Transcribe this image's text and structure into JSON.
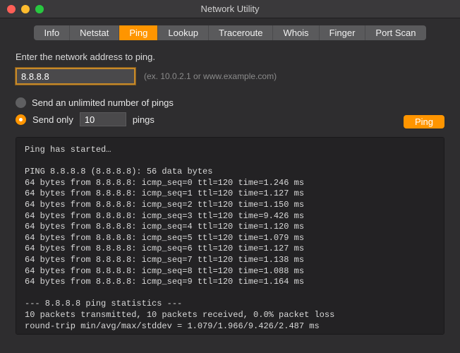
{
  "window": {
    "title": "Network Utility"
  },
  "tabs": {
    "info": "Info",
    "netstat": "Netstat",
    "ping": "Ping",
    "lookup": "Lookup",
    "traceroute": "Traceroute",
    "whois": "Whois",
    "finger": "Finger",
    "portscan": "Port Scan"
  },
  "form": {
    "prompt": "Enter the network address to ping.",
    "address": "8.8.8.8",
    "hint": "(ex. 10.0.2.1 or www.example.com)",
    "unlimited_label": "Send an unlimited number of pings",
    "sendonly_label": "Send only",
    "count": "10",
    "pings_suffix": "pings",
    "ping_button": "Ping"
  },
  "output": {
    "started": "Ping has started…",
    "header": "PING 8.8.8.8 (8.8.8.8): 56 data bytes",
    "lines": [
      "64 bytes from 8.8.8.8: icmp_seq=0 ttl=120 time=1.246 ms",
      "64 bytes from 8.8.8.8: icmp_seq=1 ttl=120 time=1.127 ms",
      "64 bytes from 8.8.8.8: icmp_seq=2 ttl=120 time=1.150 ms",
      "64 bytes from 8.8.8.8: icmp_seq=3 ttl=120 time=9.426 ms",
      "64 bytes from 8.8.8.8: icmp_seq=4 ttl=120 time=1.120 ms",
      "64 bytes from 8.8.8.8: icmp_seq=5 ttl=120 time=1.079 ms",
      "64 bytes from 8.8.8.8: icmp_seq=6 ttl=120 time=1.127 ms",
      "64 bytes from 8.8.8.8: icmp_seq=7 ttl=120 time=1.138 ms",
      "64 bytes from 8.8.8.8: icmp_seq=8 ttl=120 time=1.088 ms",
      "64 bytes from 8.8.8.8: icmp_seq=9 ttl=120 time=1.164 ms"
    ],
    "stats_divider": "--- 8.8.8.8 ping statistics ---",
    "stats_summary": "10 packets transmitted, 10 packets received, 0.0% packet loss",
    "stats_rtt": "round-trip min/avg/max/stddev = 1.079/1.966/9.426/2.487 ms"
  }
}
